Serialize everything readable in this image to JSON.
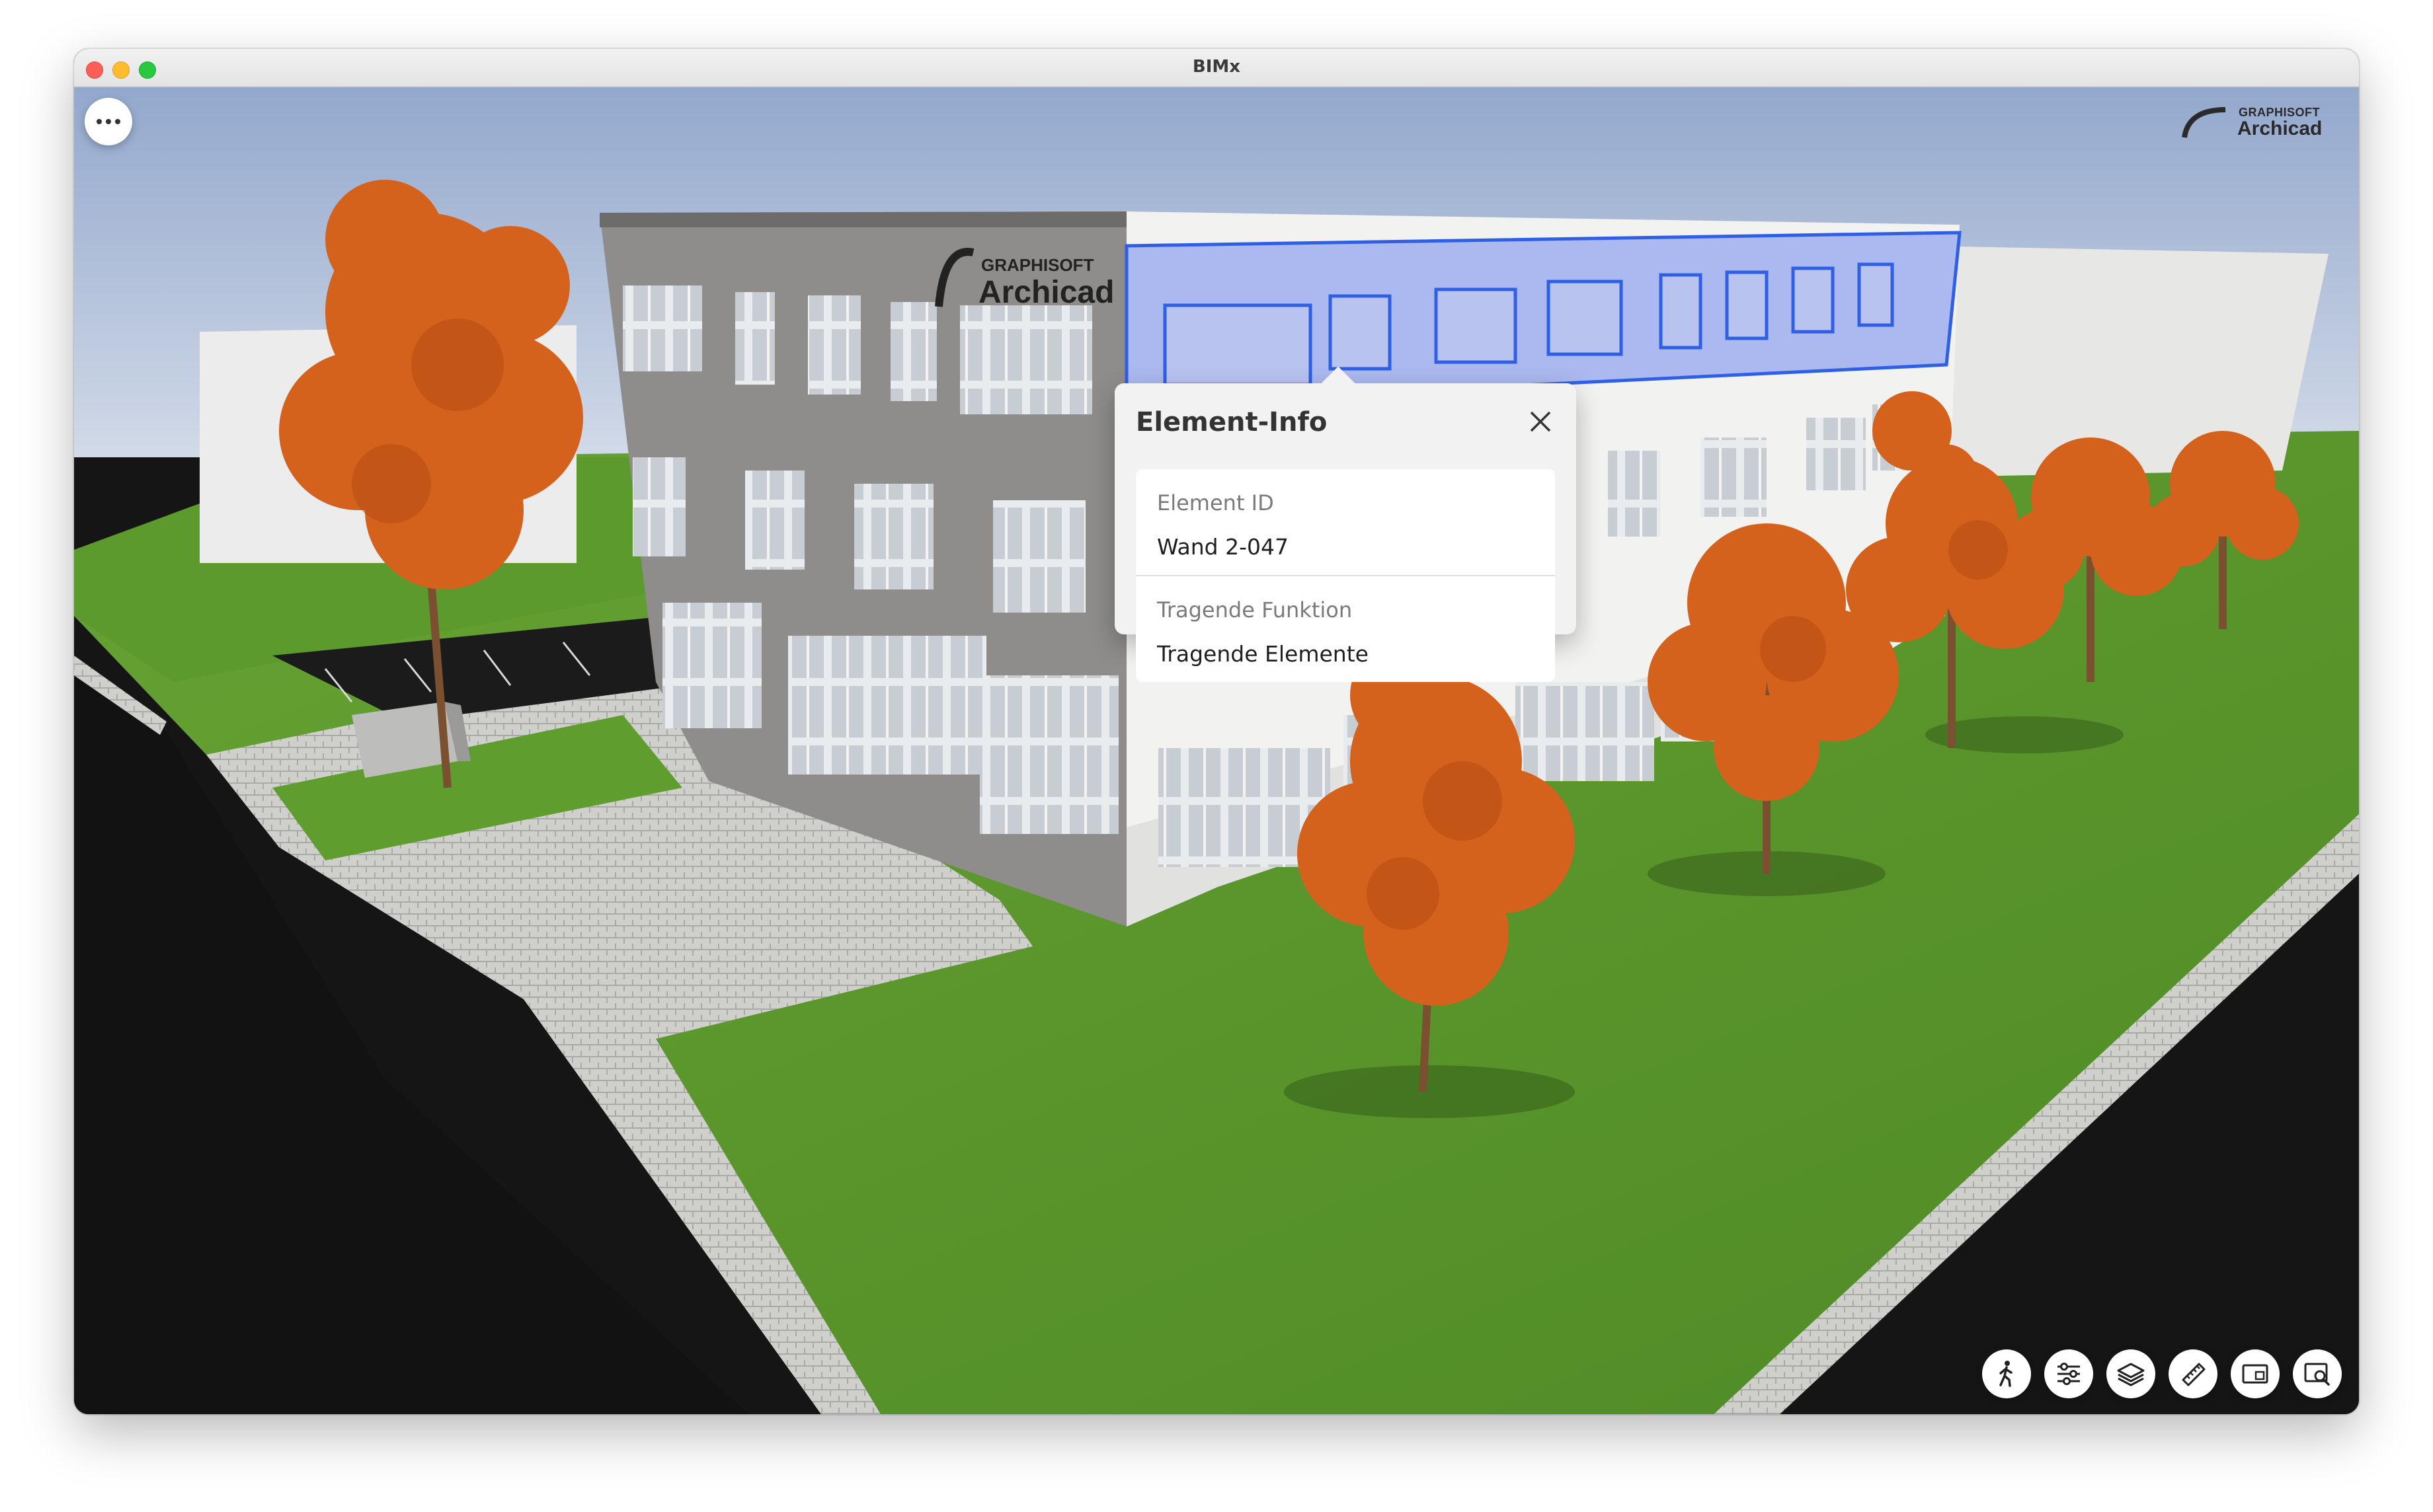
{
  "window": {
    "title": "BIMx"
  },
  "brand": {
    "line1": "GRAPHISOFT",
    "line2": "Archicad"
  },
  "building_logo": {
    "line1": "GRAPHISOFT",
    "line2": "Archicad"
  },
  "popover": {
    "title": "Element-Info",
    "fields": [
      {
        "label": "Element ID",
        "value": "Wand 2-047"
      },
      {
        "label": "Tragende Funktion",
        "value": "Tragende Elemente"
      }
    ]
  },
  "toolbar": {
    "tools": [
      {
        "icon": "walk-icon"
      },
      {
        "icon": "settings-sliders-icon"
      },
      {
        "icon": "layers-icon"
      },
      {
        "icon": "measure-ruler-icon"
      },
      {
        "icon": "layout-sheet-icon"
      },
      {
        "icon": "search-view-icon"
      }
    ]
  },
  "colors": {
    "selection": "#3a67e8",
    "grass": "#5f9b2f",
    "tree": "#d2621f",
    "sky_top": "#9aaed0"
  }
}
